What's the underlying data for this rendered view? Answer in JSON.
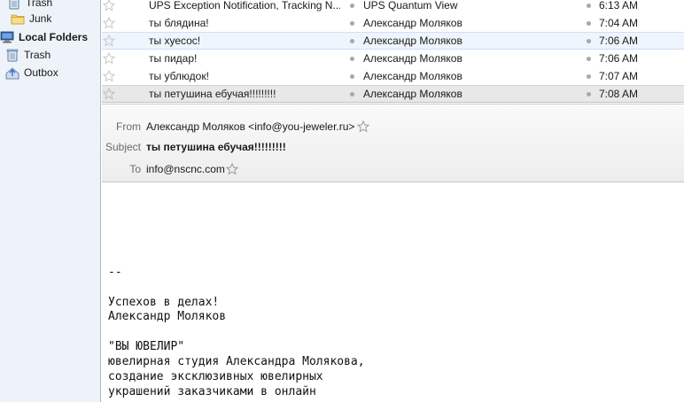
{
  "folders": [
    {
      "label": "Trash",
      "icon": "trash-icon",
      "bold": false
    },
    {
      "label": "Junk",
      "icon": "folder-icon",
      "bold": false
    },
    {
      "label": "Local Folders",
      "icon": "computer-icon",
      "bold": true
    },
    {
      "label": "Trash",
      "icon": "trash-icon",
      "bold": false
    },
    {
      "label": "Outbox",
      "icon": "outbox-icon",
      "bold": false
    }
  ],
  "messages": [
    {
      "subject": "UPS Exception Notification, Tracking N...",
      "from": "UPS Quantum View",
      "date": "6:13 AM"
    },
    {
      "subject": "ты блядина!",
      "from": "Александр Моляков",
      "date": "7:04 AM"
    },
    {
      "subject": "ты хуесос!",
      "from": "Александр Моляков",
      "date": "7:06 AM"
    },
    {
      "subject": "ты пидар!",
      "from": "Александр Моляков",
      "date": "7:06 AM"
    },
    {
      "subject": "ты ублюдок!",
      "from": "Александр Моляков",
      "date": "7:07 AM"
    },
    {
      "subject": "ты петушина ебучая!!!!!!!!!",
      "from": "Александр Моляков",
      "date": "7:08 AM"
    }
  ],
  "header": {
    "from_label": "From",
    "from_value": "Александр Моляков <info@you-jeweler.ru>",
    "subject_label": "Subject",
    "subject_value": "ты петушина ебучая!!!!!!!!!",
    "to_label": "To",
    "to_value": "info@nscnc.com"
  },
  "body_lines": [
    "--",
    "",
    "Успехов в делах!",
    "Александр Моляков",
    "",
    "\"ВЫ ЮВЕЛИР\"",
    "ювелирная студия Александра Молякова,",
    "создание эксклюзивных ювелирных",
    "украшений заказчиками в онлайн"
  ],
  "colors": {
    "folder_pane_bg": "#eef3fa",
    "selected_row_bg": "#e8e8e8",
    "highlight_row_bg": "#eef5fc"
  }
}
